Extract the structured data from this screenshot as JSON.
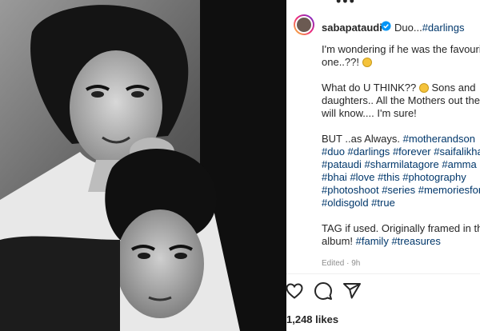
{
  "post": {
    "username": "sabapataudi",
    "header_caption_prefix": "Duo...",
    "header_caption_tag": "#darlings",
    "more_icon": "ellipsis-icon",
    "caption": {
      "line1": "I'm wondering if he was the favourite",
      "line2": "one..??!",
      "line3": "What do U THINK?? ",
      "line3_end": " Sons and",
      "line4": "daughters.. All the Mothers out there",
      "line5": "will know.... I'm sure!",
      "line6_text": "BUT ..as Always. ",
      "line6_tag": "#motherandson",
      "tags_row1": [
        "#duo",
        "#darlings",
        "#forever",
        "#saifalikhan"
      ],
      "tags_row2": [
        "#pataudi",
        "#sharmilatagore",
        "#amma"
      ],
      "tags_row3": [
        "#bhai",
        "#love",
        "#this",
        "#photography"
      ],
      "tags_row4": [
        "#photoshoot",
        "#series",
        "#memoriesforlife"
      ],
      "tags_row5": [
        "#oldisgold",
        "#true"
      ],
      "line_tag": "TAG if used. Originally framed in the",
      "line_album_text": "album! ",
      "line_album_tags": [
        "#family",
        "#treasures"
      ]
    },
    "edited": "Edited · 9h",
    "likes": "1,248 likes"
  },
  "colors": {
    "text": "#262626",
    "hashtag": "#00376b",
    "muted": "#8e8e8e",
    "verified": "#0095f6"
  }
}
